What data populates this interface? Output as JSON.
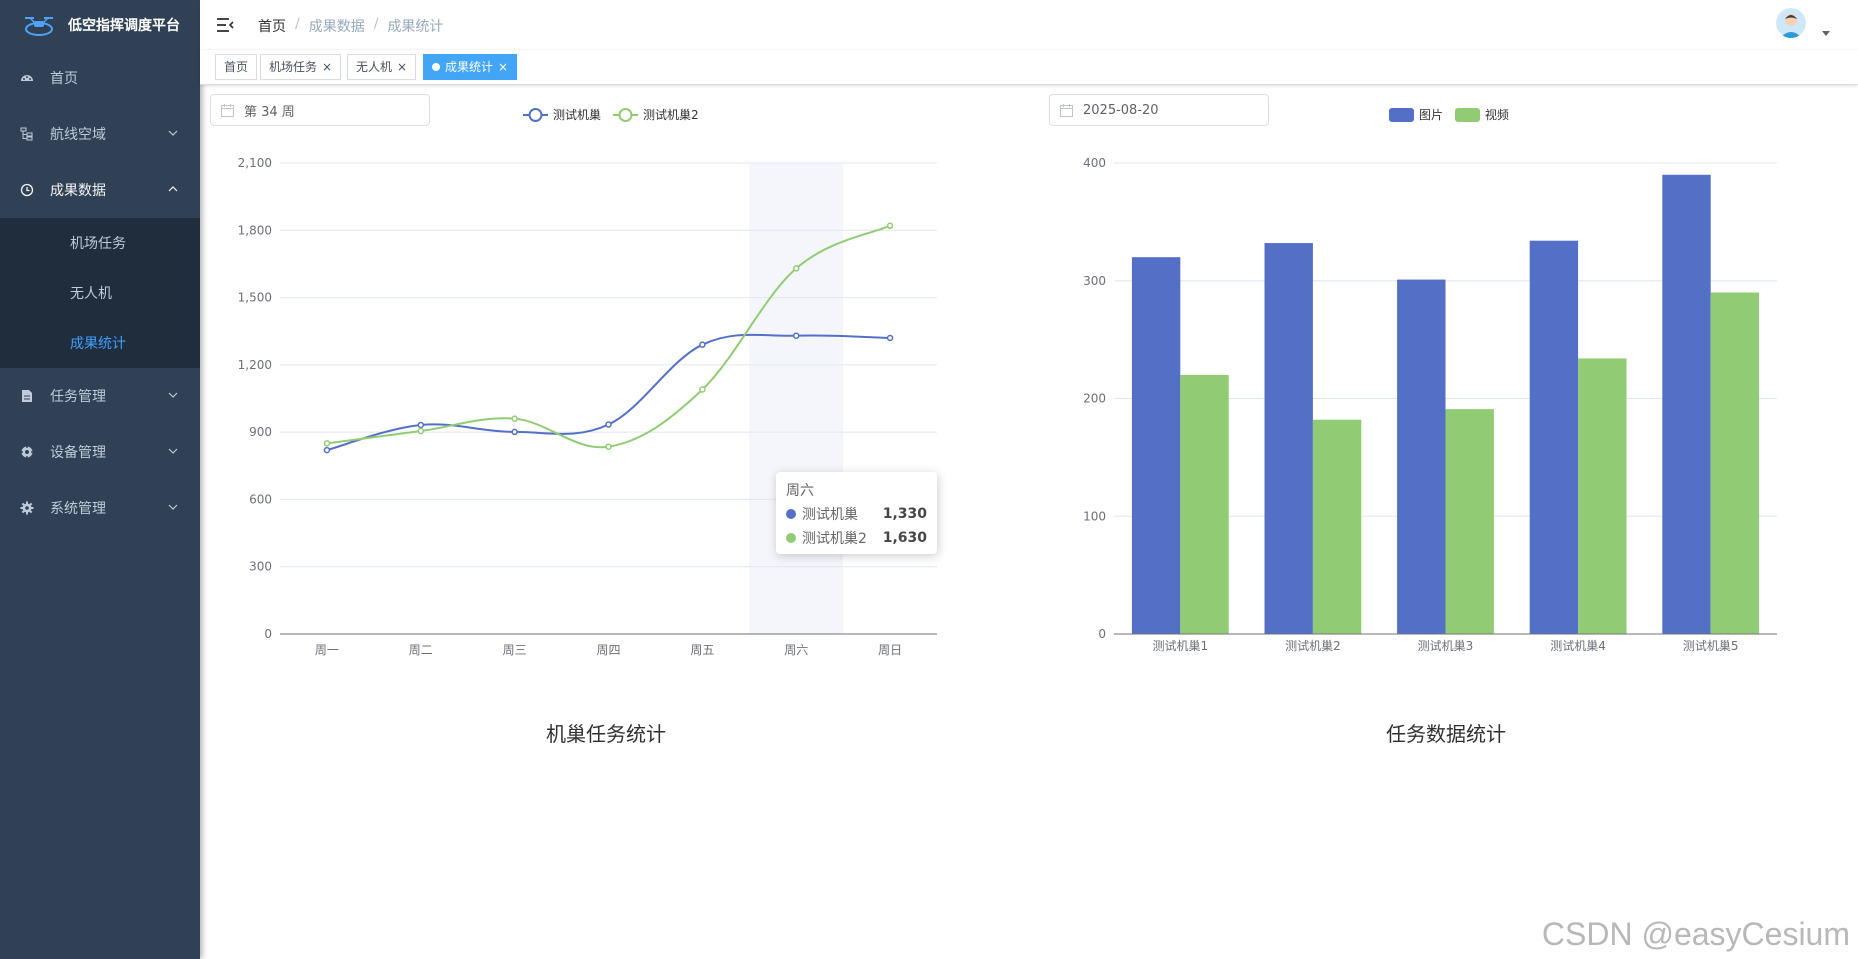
{
  "app": {
    "title": "低空指挥调度平台"
  },
  "sidebar": {
    "items": [
      {
        "label": "首页",
        "icon": "dashboard-icon"
      },
      {
        "label": "航线空域",
        "icon": "tree-icon"
      },
      {
        "label": "成果数据",
        "icon": "clock-icon"
      },
      {
        "label": "任务管理",
        "icon": "document-icon"
      },
      {
        "label": "设备管理",
        "icon": "target-icon"
      },
      {
        "label": "系统管理",
        "icon": "gear-icon"
      }
    ],
    "submenu": [
      {
        "label": "机场任务"
      },
      {
        "label": "无人机"
      },
      {
        "label": "成果统计"
      }
    ]
  },
  "breadcrumb": [
    "首页",
    "成果数据",
    "成果统计"
  ],
  "tags": [
    {
      "label": "首页"
    },
    {
      "label": "机场任务"
    },
    {
      "label": "无人机"
    },
    {
      "label": "成果统计"
    }
  ],
  "pickers": {
    "week": "第 34 周",
    "date": "2025-08-20"
  },
  "colors": {
    "blue": "#5470c6",
    "green": "#91cc75",
    "accent": "#409eff",
    "sidebar": "#304156"
  },
  "chart_data": [
    {
      "type": "line",
      "title": "机巢任务统计",
      "categories": [
        "周一",
        "周二",
        "周三",
        "周四",
        "周五",
        "周六",
        "周日"
      ],
      "series": [
        {
          "name": "测试机巢",
          "values": [
            820,
            932,
            901,
            934,
            1290,
            1330,
            1320
          ]
        },
        {
          "name": "测试机巢2",
          "values": [
            850,
            905,
            960,
            835,
            1090,
            1630,
            1820
          ]
        }
      ],
      "yticks": [
        "0",
        "300",
        "600",
        "900",
        "1,200",
        "1,500",
        "1,800",
        "2,100"
      ],
      "ylim": [
        0,
        2100
      ],
      "smooth": true,
      "legend": "top-center",
      "highlight_index": 5,
      "tooltip": {
        "title": "周六",
        "rows": [
          {
            "name": "测试机巢",
            "value": "1,330"
          },
          {
            "name": "测试机巢2",
            "value": "1,630"
          }
        ]
      }
    },
    {
      "type": "bar",
      "title": "任务数据统计",
      "categories": [
        "测试机巢1",
        "测试机巢2",
        "测试机巢3",
        "测试机巢4",
        "测试机巢5"
      ],
      "series": [
        {
          "name": "图片",
          "values": [
            320,
            332,
            301,
            334,
            390
          ]
        },
        {
          "name": "视频",
          "values": [
            220,
            182,
            191,
            234,
            290
          ]
        }
      ],
      "yticks": [
        "0",
        "100",
        "200",
        "300",
        "400"
      ],
      "ylim": [
        0,
        400
      ],
      "legend": "top-center"
    }
  ],
  "watermark": "CSDN @easyCesium"
}
